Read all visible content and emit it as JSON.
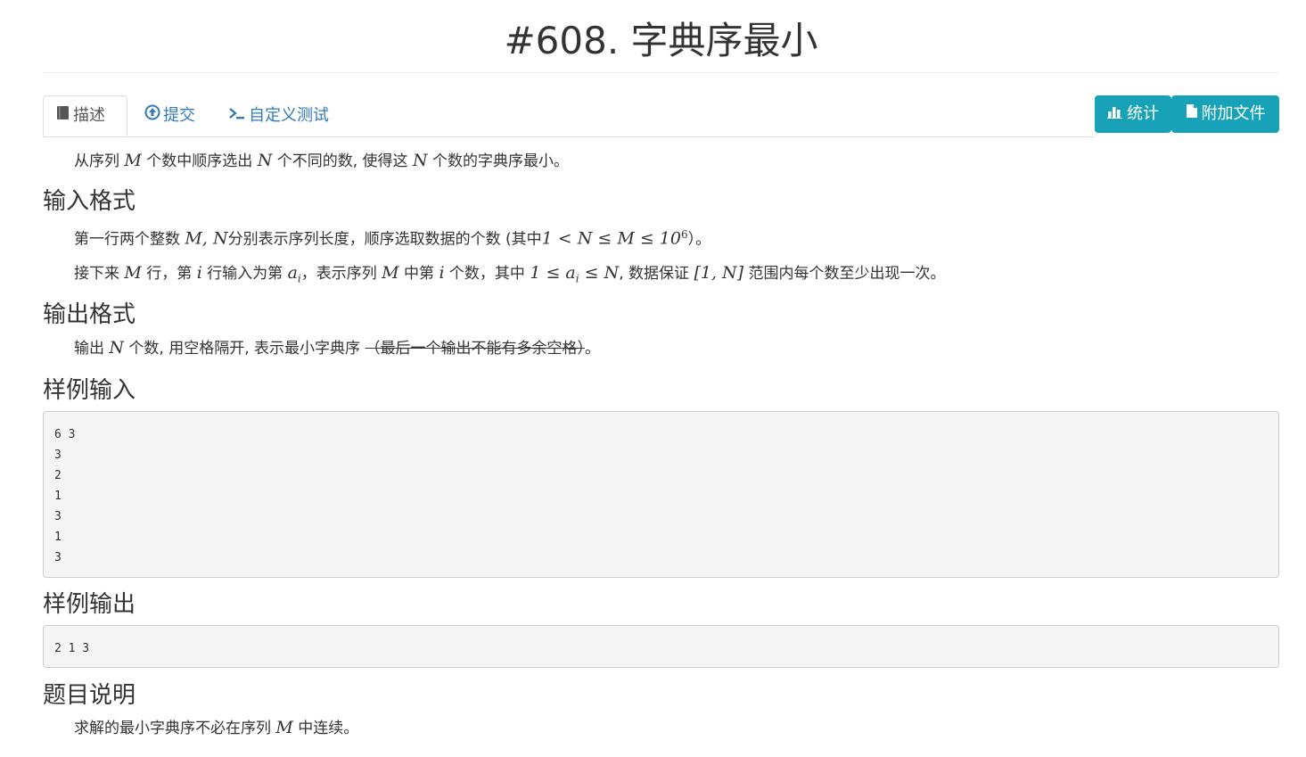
{
  "problem": {
    "title": "#608. 字典序最小"
  },
  "tabs": [
    {
      "label": "描述",
      "icon": "book-icon",
      "active": true
    },
    {
      "label": "提交",
      "icon": "upload-circle-icon"
    },
    {
      "label": "自定义测试",
      "icon": "terminal-icon"
    }
  ],
  "buttons": {
    "stats": {
      "label": "统计",
      "icon": "bar-chart-icon"
    },
    "attachments": {
      "label": "附加文件",
      "icon": "file-icon"
    }
  },
  "description": {
    "text_a": "从序列 ",
    "var_m": "M",
    "text_b": " 个数中顺序选出 ",
    "var_n": "N",
    "text_c": " 个不同的数, 使得这 ",
    "text_d": " 个数的字典序最小。"
  },
  "input_format": {
    "heading": "输入格式",
    "line1": {
      "a": "第一行两个整数 ",
      "vars": "M, N",
      "b": "分别表示序列长度，顺序选取数据的个数 (其中",
      "math": "1 < N ≤ M ≤ 10",
      "exp": "6",
      "c": "）。"
    },
    "line2": {
      "a": "接下来 ",
      "m": "M",
      "b": " 行，第 ",
      "i": "i",
      "c": " 行输入为第 ",
      "ai": "a",
      "sub_i": "i",
      "d": "，表示序列 ",
      "e": " 中第 ",
      "f": " 个数，其中 ",
      "range": "1 ≤ a",
      "range_sub": "i",
      "range_end": " ≤ N",
      "g": ", 数据保证 ",
      "interval": "[1, N]",
      "h": " 范围内每个数至少出现一次。"
    }
  },
  "output_format": {
    "heading": "输出格式",
    "a": "输出 ",
    "n": "N",
    "b": " 个数, 用空格隔开, 表示最小字典序 ",
    "struck": "（最后一个输出不能有多余空格）",
    "c": "。"
  },
  "sample_input": {
    "heading": "样例输入",
    "content": "6 3\n3\n2\n1\n3\n1\n3"
  },
  "sample_output": {
    "heading": "样例输出",
    "content": "2 1 3"
  },
  "notes": {
    "heading": "题目说明",
    "a": "求解的最小字典序不必在序列 ",
    "m": "M",
    "b": " 中连续。"
  },
  "colors": {
    "accent": "#17a2b8",
    "link": "#337ab7",
    "text": "#333333"
  }
}
